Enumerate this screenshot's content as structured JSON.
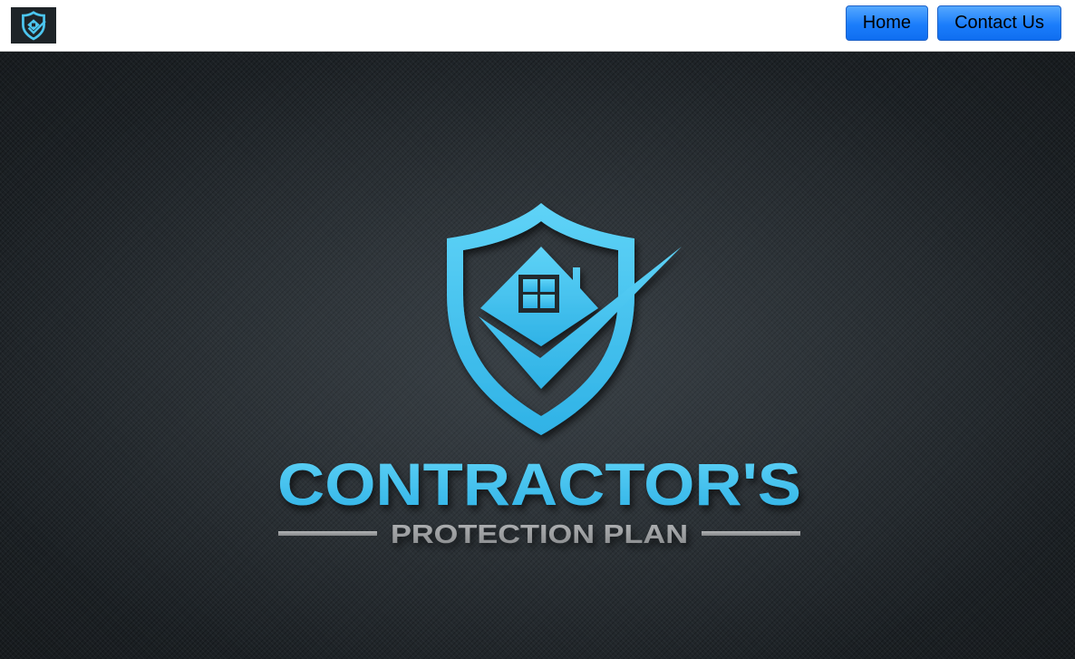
{
  "header": {
    "logo_icon": "shield-house-check-icon",
    "nav": {
      "home_label": "Home",
      "contact_label": "Contact Us"
    }
  },
  "hero": {
    "logo_title": "CONTRACTOR'S",
    "logo_subtitle": "PROTECTION PLAN",
    "logo_icon": "shield-house-check-icon"
  },
  "colors": {
    "accent": "#4cc6f0",
    "button": "#1b7dfb",
    "background": "#1e2428",
    "subtitle": "#9a9c9e"
  }
}
